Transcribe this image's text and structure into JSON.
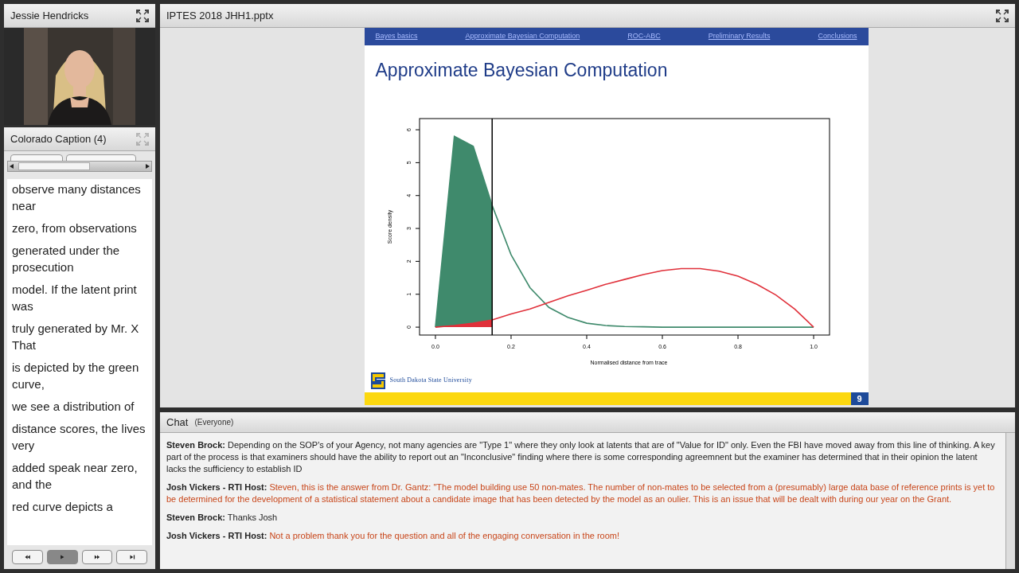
{
  "presenter_pod": {
    "title": "Jessie Hendricks"
  },
  "caption_pod": {
    "title": "Colorado Caption (4)",
    "lines": [
      "observe many distances near",
      "zero, from observations",
      "generated under the prosecution",
      "model. If the latent print was",
      "truly generated by Mr. X That",
      "is depicted by the green curve,",
      "we see a distribution of",
      "distance scores, the lives very",
      "added speak near zero, and the",
      "red curve depicts a"
    ],
    "controls": [
      {
        "kind": "rewind",
        "selected": false
      },
      {
        "kind": "play",
        "selected": true
      },
      {
        "kind": "forward",
        "selected": false
      },
      {
        "kind": "end",
        "selected": false
      }
    ]
  },
  "share_pod": {
    "title": "IPTES 2018 JHH1.pptx",
    "slide": {
      "nav": [
        "Bayes basics",
        "Approximate Bayesian Computation",
        "ROC-ABC",
        "Preliminary Results",
        "Conclusions"
      ],
      "title": "Approximate Bayesian Computation",
      "logo_text": "South Dakota State University",
      "page_number": "9",
      "chart_data": {
        "type": "line",
        "xlabel": "Normalised distance from trace",
        "ylabel": "Score density",
        "x": [
          0,
          0.05,
          0.1,
          0.15,
          0.2,
          0.25,
          0.3,
          0.35,
          0.4,
          0.45,
          0.5,
          0.55,
          0.6,
          0.65,
          0.7,
          0.75,
          0.8,
          0.85,
          0.9,
          0.95,
          1
        ],
        "series": [
          {
            "color": "#3f8a6c",
            "values": [
              0,
              5.8,
              5.5,
              3.7,
              2.2,
              1.2,
              0.6,
              0.3,
              0.12,
              0.05,
              0.02,
              0.01,
              0,
              0,
              0,
              0,
              0,
              0,
              0,
              0,
              0
            ]
          },
          {
            "color": "#e0303a",
            "values": [
              0,
              0.05,
              0.12,
              0.22,
              0.4,
              0.55,
              0.75,
              0.95,
              1.12,
              1.3,
              1.45,
              1.6,
              1.72,
              1.78,
              1.78,
              1.7,
              1.55,
              1.3,
              0.98,
              0.55,
              0
            ]
          }
        ],
        "xlim": [
          -0.042,
          1.042
        ],
        "ylim": [
          -0.24,
          6.34
        ],
        "xticks": [
          {
            "value": 0,
            "label": "0.0"
          },
          {
            "value": 0.2,
            "label": "0.2"
          },
          {
            "value": 0.4,
            "label": "0.4"
          },
          {
            "value": 0.6,
            "label": "0.6"
          },
          {
            "value": 0.8,
            "label": "0.8"
          },
          {
            "value": 1,
            "label": "1.0"
          }
        ],
        "yticks": [
          0,
          1,
          2,
          3,
          4,
          5,
          6
        ],
        "ref_lines": [
          {
            "axis": "x",
            "value": 0.15
          }
        ]
      }
    }
  },
  "chat_pod": {
    "title": "Chat",
    "audience": "(Everyone)",
    "messages": [
      {
        "kind": "attendee",
        "name": "Steven Brock:",
        "text": "Depending on the SOP's of your Agency, not many agencies are \"Type 1\" where they only look at latents that are of \"Value for ID\" only. Even the FBI have moved away from this line of thinking. A key part of the process is that examiners should have the ability to report out an \"Inconclusive\" finding where there is some corresponding agreemnent but the examiner has determined that in their opinion the latent lacks the sufficiency to establish ID"
      },
      {
        "kind": "host",
        "name": "Josh Vickers - RTI Host:",
        "text": "Steven, this is the answer from Dr. Gantz: \"The model building use 50 non-mates.  The number of non-mates to be selected from a (presumably) large data base of reference prints is yet to be determined for the development of a statistical statement about a candidate image that has been detected by the model as an oulier.  This is an issue that will be dealt with during our year on the Grant."
      },
      {
        "kind": "attendee",
        "name": "Steven Brock:",
        "text": "Thanks Josh"
      },
      {
        "kind": "host",
        "name": "Josh Vickers - RTI Host:",
        "text": "Not a problem thank you for the question and all of the engaging conversation in the room!"
      }
    ]
  }
}
